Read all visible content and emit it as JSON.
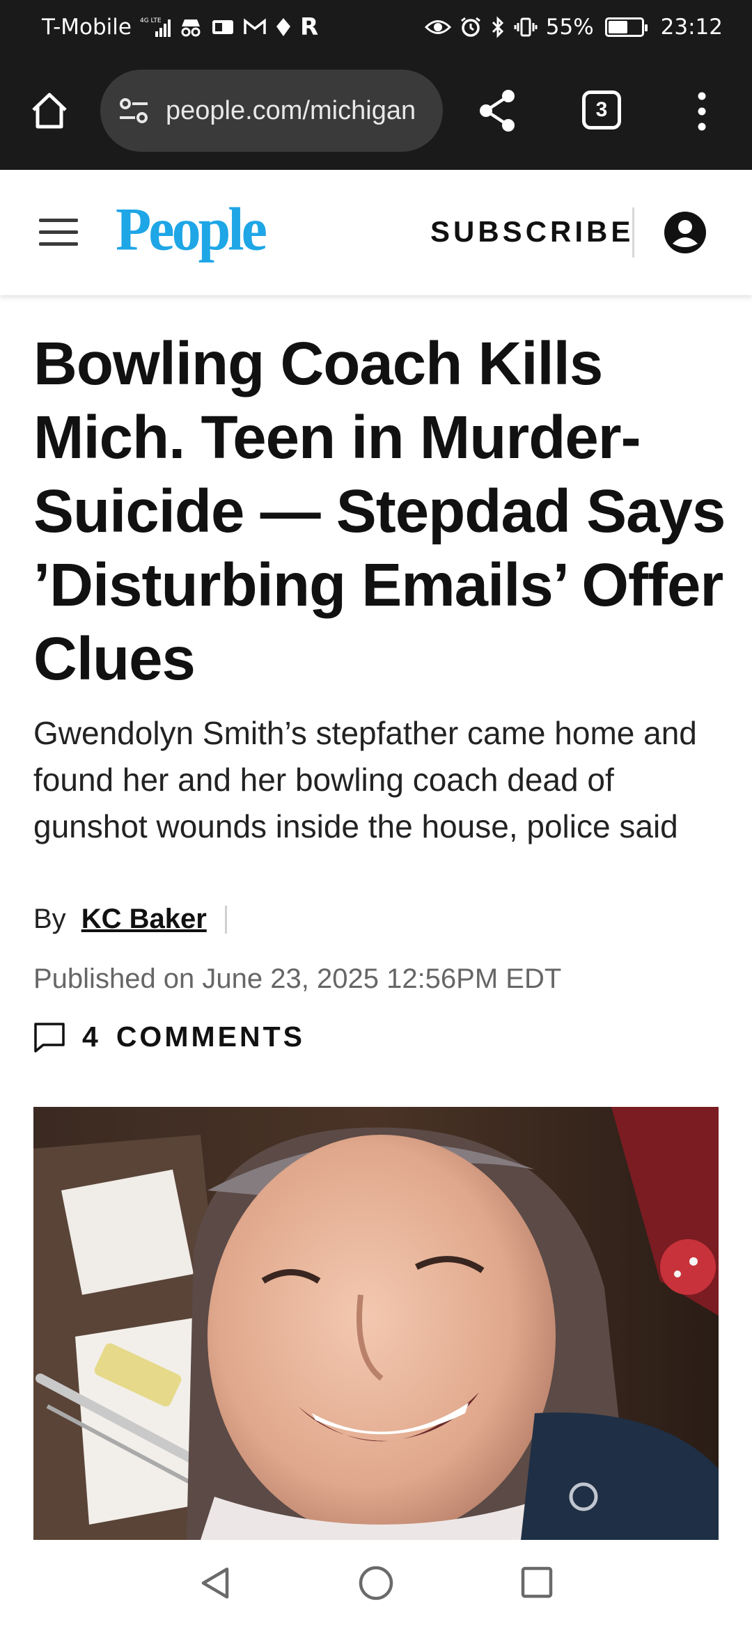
{
  "status_bar": {
    "carrier": "T-Mobile",
    "network_badge": "4G LTE",
    "battery_percent": "55%",
    "battery_level": 0.55,
    "time": "23:12",
    "left_icons": [
      "signal-icon",
      "incognito-icon",
      "mail-app-icon",
      "gmail-icon",
      "location-icon",
      "r-app-icon"
    ],
    "right_icons": [
      "eye-comfort-icon",
      "alarm-icon",
      "bluetooth-icon",
      "vibrate-icon",
      "battery-icon"
    ],
    "r_app_letter": "R"
  },
  "browser": {
    "url": "people.com/michigan",
    "tab_count": "3"
  },
  "site_header": {
    "logo_text": "People",
    "logo_color": "#1ea6e6",
    "subscribe_label": "SUBSCRIBE"
  },
  "article": {
    "headline": "Bowling Coach Kills Mich. Teen in Murder-Suicide — Stepdad Says ’Disturbing Emails’ Offer Clues",
    "dek": "Gwendolyn Smith’s stepfather came home and found her and her bowling coach dead of gunshot wounds inside the house, police said",
    "by_label": "By",
    "author": "KC Baker",
    "published": "Published on June 23, 2025 12:56PM EDT",
    "comments_count": "4",
    "comments_label": "COMMENTS"
  },
  "hero_image": {
    "description_icon": "photo-of-smiling-teen"
  },
  "nav_bar": {
    "buttons": [
      "back-icon",
      "home-icon",
      "recents-icon"
    ]
  }
}
